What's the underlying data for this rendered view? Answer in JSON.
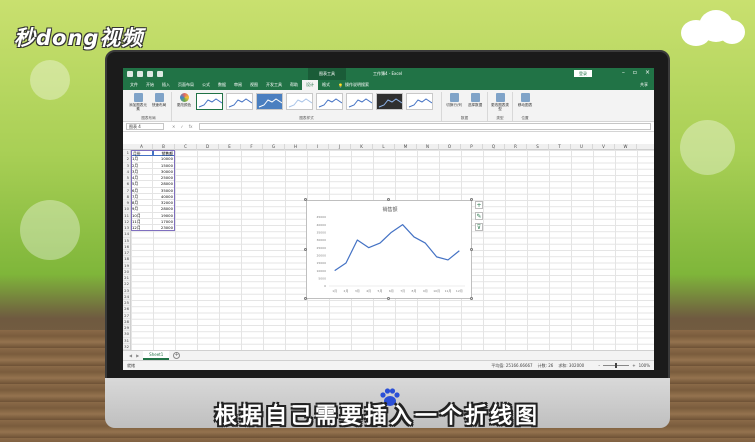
{
  "brand": {
    "logo_text": "秒dong视频"
  },
  "subtitle": "根据自己需要插入一个折线图",
  "excel": {
    "title": "工作簿4 - Excel",
    "context_tab": "图表工具",
    "login": "登录",
    "share": "共享",
    "tell_me": "操作说明搜索",
    "tabs": [
      "文件",
      "开始",
      "插入",
      "页面布局",
      "公式",
      "数据",
      "审阅",
      "视图",
      "开发工具",
      "帮助",
      "设计",
      "格式"
    ],
    "active_tab": "设计",
    "ribbon": {
      "group_layout": {
        "label": "图表布局",
        "buttons": [
          {
            "label": "添加图表元素"
          },
          {
            "label": "快速布局"
          }
        ]
      },
      "group_colors": {
        "label": "更改颜色"
      },
      "group_styles": {
        "label": "图表样式"
      },
      "group_data": {
        "label": "数据",
        "buttons": [
          {
            "label": "切换行/列"
          },
          {
            "label": "选择数据"
          }
        ]
      },
      "group_type": {
        "label": "类型",
        "buttons": [
          {
            "label": "更改图表类型"
          }
        ]
      },
      "group_location": {
        "label": "位置",
        "buttons": [
          {
            "label": "移动图表"
          }
        ]
      }
    },
    "name_box": "图表 4",
    "columns": [
      "A",
      "B",
      "C",
      "D",
      "E",
      "F",
      "G",
      "H",
      "I",
      "J",
      "K",
      "L",
      "M",
      "N",
      "O",
      "P",
      "Q",
      "R",
      "S",
      "T",
      "U",
      "V",
      "W"
    ],
    "rows": [
      "1",
      "2",
      "3",
      "4",
      "5",
      "6",
      "7",
      "8",
      "9",
      "10",
      "11",
      "12",
      "13",
      "14",
      "15",
      "16",
      "17",
      "18",
      "19",
      "20",
      "21",
      "22",
      "23",
      "24",
      "25",
      "26",
      "27",
      "28",
      "29",
      "30",
      "31",
      "32"
    ],
    "table": {
      "headers": [
        "月份",
        "销售额"
      ],
      "rows": [
        [
          "1月",
          "10000"
        ],
        [
          "2月",
          "15000"
        ],
        [
          "3月",
          "30000"
        ],
        [
          "4月",
          "25000"
        ],
        [
          "5月",
          "28000"
        ],
        [
          "6月",
          "35000"
        ],
        [
          "7月",
          "40000"
        ],
        [
          "8月",
          "32000"
        ],
        [
          "9月",
          "28000"
        ],
        [
          "10月",
          "19000"
        ],
        [
          "11月",
          "17000"
        ],
        [
          "12月",
          "23000"
        ]
      ]
    },
    "sheet_tab": "Sheet1",
    "status": {
      "ready": "就绪",
      "average": "平均值: 25166.66667",
      "count": "计数: 26",
      "sum": "求和: 302000",
      "zoom": "100%"
    }
  },
  "chart_data": {
    "type": "line",
    "title": "销售额",
    "categories": [
      "1月",
      "2月",
      "3月",
      "4月",
      "5月",
      "6月",
      "7月",
      "8月",
      "9月",
      "10月",
      "11月",
      "12月"
    ],
    "series": [
      {
        "name": "销售额",
        "values": [
          10000,
          15000,
          30000,
          25000,
          28000,
          35000,
          40000,
          32000,
          28000,
          19000,
          17000,
          23000
        ],
        "color": "#4472c4"
      }
    ],
    "ylim": [
      0,
      45000
    ],
    "yticks": [
      "45000",
      "40000",
      "35000",
      "30000",
      "25000",
      "20000",
      "15000",
      "10000",
      "5000",
      "0"
    ],
    "grid": false,
    "legend": "none"
  },
  "colors": {
    "excel_green": "#217346",
    "line_blue": "#4472c4"
  }
}
